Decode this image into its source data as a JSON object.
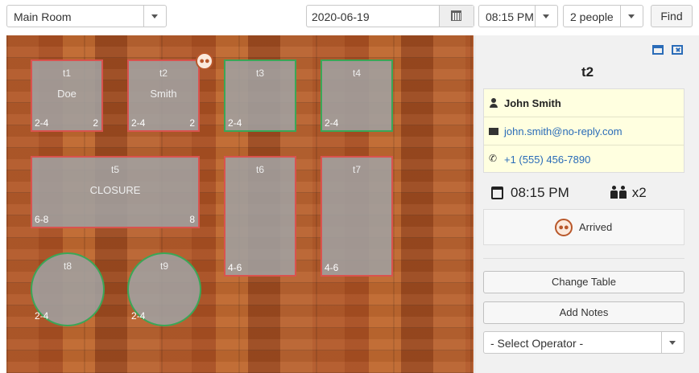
{
  "toolbar": {
    "room": "Main Room",
    "date": "2020-06-19",
    "time": "08:15 PM",
    "party": "2 people",
    "find_label": "Find"
  },
  "floor": {
    "tables": [
      {
        "id": "t1",
        "guest": "Doe",
        "capacity": "2-4",
        "count": "2",
        "status": "occupied"
      },
      {
        "id": "t2",
        "guest": "Smith",
        "capacity": "2-4",
        "count": "2",
        "status": "occupied"
      },
      {
        "id": "t3",
        "guest": "",
        "capacity": "2-4",
        "count": "",
        "status": "available"
      },
      {
        "id": "t4",
        "guest": "",
        "capacity": "2-4",
        "count": "",
        "status": "available"
      },
      {
        "id": "t5",
        "guest": "CLOSURE",
        "capacity": "6-8",
        "count": "8",
        "status": "occupied"
      },
      {
        "id": "t6",
        "guest": "",
        "capacity": "4-6",
        "count": "",
        "status": "occupied"
      },
      {
        "id": "t7",
        "guest": "",
        "capacity": "4-6",
        "count": "",
        "status": "occupied"
      },
      {
        "id": "t8",
        "guest": "",
        "capacity": "2-4",
        "count": "",
        "status": "available"
      },
      {
        "id": "t9",
        "guest": "",
        "capacity": "2-4",
        "count": "",
        "status": "available"
      }
    ]
  },
  "panel": {
    "title": "t2",
    "name": "John Smith",
    "email": "john.smith@no-reply.com",
    "phone": "+1 (555) 456-7890",
    "time": "08:15 PM",
    "party": "x2",
    "status": "Arrived",
    "change_table_label": "Change Table",
    "add_notes_label": "Add Notes",
    "operator_placeholder": "- Select Operator -"
  },
  "colors": {
    "occupied_border": "#d9534f",
    "available_border": "#3aa757",
    "link": "#2a6cb8",
    "info_bg": "#ffffe0",
    "arrived": "#b8572a"
  }
}
